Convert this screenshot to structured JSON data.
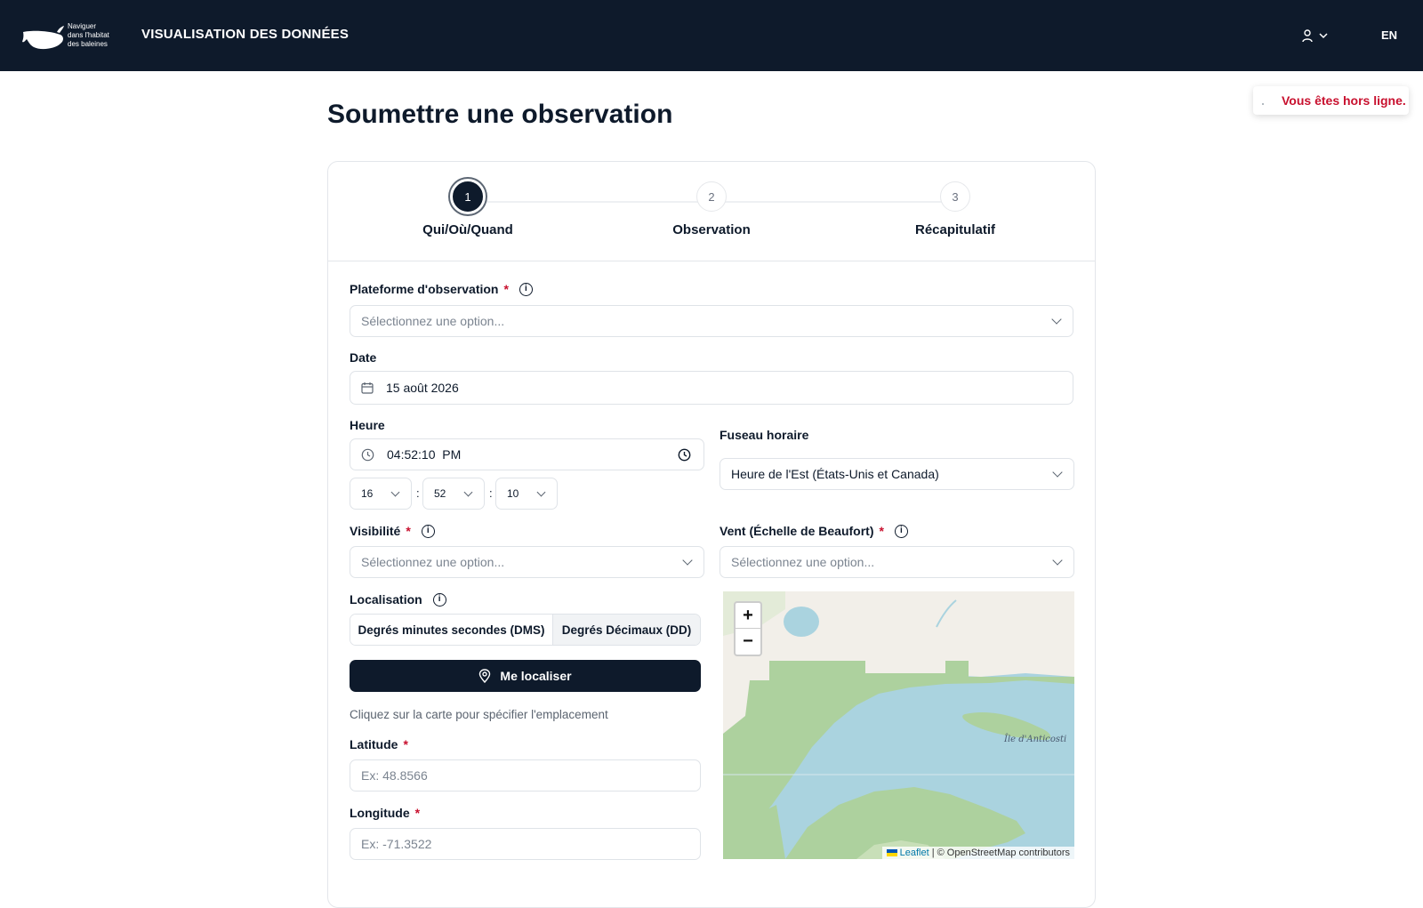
{
  "header": {
    "logo_text": [
      "Naviguer",
      "dans l'habitat",
      "des baleines"
    ],
    "app_title": "VISUALISATION DES DONNÉES",
    "user_icon": "user-icon",
    "language": "EN"
  },
  "toast": {
    "message": "Vous êtes hors ligne."
  },
  "page_title": "Soumettre une observation",
  "stepper": {
    "steps": [
      {
        "number": "1",
        "label": "Qui/Où/Quand",
        "active": true
      },
      {
        "number": "2",
        "label": "Observation",
        "active": false
      },
      {
        "number": "3",
        "label": "Récapitulatif",
        "active": false
      }
    ]
  },
  "form": {
    "platform": {
      "label": "Plateforme d'observation",
      "required": "*",
      "placeholder": "Sélectionnez une option..."
    },
    "date": {
      "label": "Date",
      "value": "15 août 2026"
    },
    "time": {
      "label": "Heure",
      "value": "04:52:10  PM",
      "hour": "16",
      "minute": "52",
      "second": "10",
      "separator": ":"
    },
    "timezone": {
      "label": "Fuseau horaire",
      "value": "Heure de l'Est (États-Unis et Canada)"
    },
    "visibility": {
      "label": "Visibilité",
      "required": "*",
      "placeholder": "Sélectionnez une option..."
    },
    "wind": {
      "label": "Vent (Échelle de Beaufort)",
      "required": "*",
      "placeholder": "Sélectionnez une option..."
    },
    "location": {
      "label": "Localisation",
      "modes": [
        "Degrés minutes secondes (DMS)",
        "Degrés Décimaux (DD)"
      ],
      "locate_button": "Me localiser",
      "hint": "Cliquez sur la carte pour spécifier l'emplacement"
    },
    "latitude": {
      "label": "Latitude",
      "required": "*",
      "placeholder": "Ex: 48.8566"
    },
    "longitude": {
      "label": "Longitude",
      "required": "*",
      "placeholder": "Ex: -71.3522"
    }
  },
  "map": {
    "zoom_in": "+",
    "zoom_out": "−",
    "attribution_link": "Leaflet",
    "attribution_text": "| © OpenStreetMap contributors",
    "place_label": "Île d'Anticosti"
  },
  "colors": {
    "primary": "#0e1a2b",
    "required": "#c8102e",
    "offline": "#c8102e"
  }
}
